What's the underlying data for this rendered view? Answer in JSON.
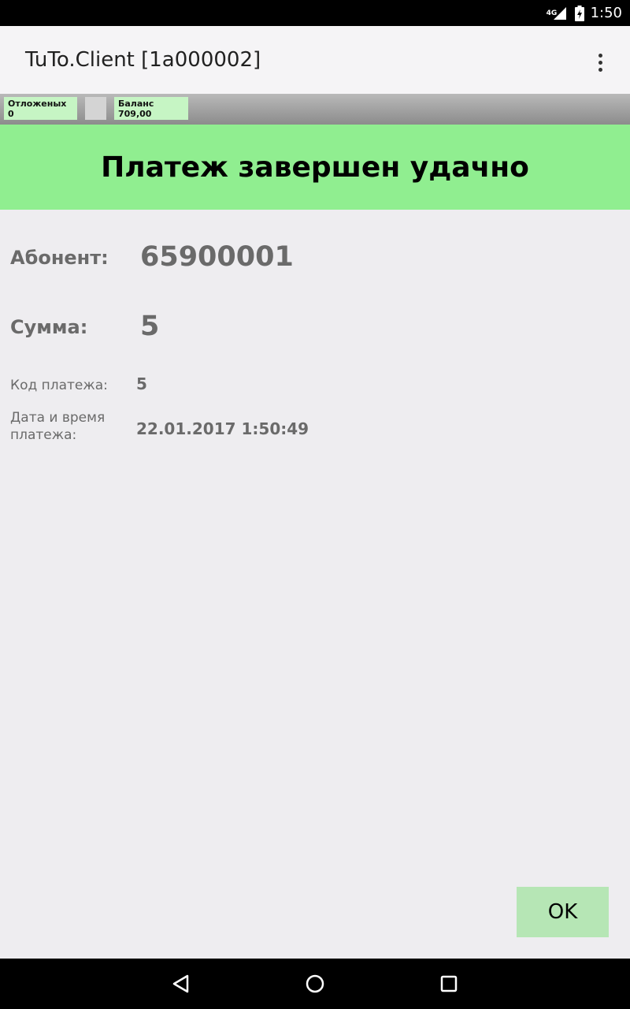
{
  "status_bar": {
    "network": "4G",
    "time": "1:50",
    "icons": [
      "signal-icon",
      "battery-icon"
    ]
  },
  "app_bar": {
    "title": "TuTo.Client [1a000002]",
    "menu_icon": "overflow-menu-icon"
  },
  "info_strip": {
    "deferred": "Отложеных 0",
    "balance": "Баланс 709,00"
  },
  "banner": {
    "text": "Платеж завершен удачно",
    "color": "#90ee90"
  },
  "details": {
    "subscriber_label": "Абонент:",
    "subscriber_value": "65900001",
    "amount_label": "Сумма:",
    "amount_value": "5",
    "code_label": "Код платежа:",
    "code_value": "5",
    "datetime_label": "Дата и время платежа:",
    "datetime_value": "22.01.2017 1:50:49"
  },
  "actions": {
    "ok_label": "OK"
  },
  "nav_bar": {
    "icons": [
      "back-icon",
      "home-icon",
      "recents-icon"
    ]
  }
}
